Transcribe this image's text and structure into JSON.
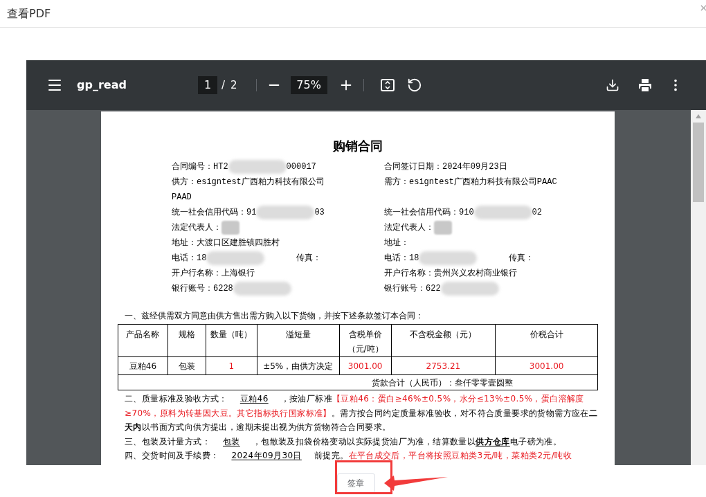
{
  "dialog": {
    "title": "查看PDF"
  },
  "viewer": {
    "file_name": "gp_read",
    "page": "1",
    "separator": "/",
    "page_count": "2",
    "zoom": "75%"
  },
  "document": {
    "title": "购销合同",
    "rows": [
      {
        "left": [
          {
            "kind": "text",
            "text": "合同编号：HT2"
          },
          {
            "kind": "redacted"
          },
          {
            "kind": "text",
            "text": "000017"
          }
        ],
        "right": [
          {
            "kind": "text",
            "text": "合同签订日期：2024年09月23日"
          }
        ]
      },
      {
        "left": [
          {
            "kind": "text",
            "text": "供方：esigntest广西粕力科技有限公司"
          }
        ],
        "right": [
          {
            "kind": "text",
            "text": "需方：esigntest广西粕力科技有限公司PAAC"
          }
        ]
      },
      {
        "left": [
          {
            "kind": "text",
            "text": "PAAD"
          }
        ],
        "right": []
      },
      {
        "left": [
          {
            "kind": "text",
            "text": "统一社会信用代码：91"
          },
          {
            "kind": "redacted"
          },
          {
            "kind": "text",
            "text": "03"
          }
        ],
        "right": [
          {
            "kind": "text",
            "text": "统一社会信用代码：910"
          },
          {
            "kind": "redacted"
          },
          {
            "kind": "text",
            "text": "02"
          }
        ]
      },
      {
        "left": [
          {
            "kind": "text",
            "text": "法定代表人："
          },
          {
            "kind": "redacted_short"
          }
        ],
        "right": [
          {
            "kind": "text",
            "text": "法定代表人："
          },
          {
            "kind": "redacted_short"
          }
        ]
      },
      {
        "left": [
          {
            "kind": "text",
            "text": "地址：大渡口区建胜镇四胜村"
          }
        ],
        "right": [
          {
            "kind": "text",
            "text": "地址："
          }
        ]
      },
      {
        "left": [
          {
            "kind": "text",
            "text": "电话：18"
          },
          {
            "kind": "redacted"
          },
          {
            "kind": "spaced",
            "text": "传真："
          }
        ],
        "right": [
          {
            "kind": "text",
            "text": "电话：18"
          },
          {
            "kind": "redacted"
          },
          {
            "kind": "spaced",
            "text": "传真："
          }
        ]
      },
      {
        "left": [
          {
            "kind": "text",
            "text": "开户行名称：上海银行"
          }
        ],
        "right": [
          {
            "kind": "text",
            "text": "开户行名称：贵州兴义农村商业银行"
          }
        ]
      },
      {
        "left": [
          {
            "kind": "text",
            "text": "银行账号：6228"
          },
          {
            "kind": "redacted"
          }
        ],
        "right": [
          {
            "kind": "text",
            "text": "银行账号：622"
          },
          {
            "kind": "redacted"
          }
        ]
      }
    ],
    "intro": "一、兹经供需双方同意由供方售出需方购入以下货物，并按下述条款签订本合同：",
    "table": {
      "columns": [
        "产品名称",
        "规格",
        "数量（吨）",
        "溢短量",
        "含税单价（元/吨）",
        "不含税金额（元）",
        "价税合计"
      ],
      "rows": [
        [
          {
            "text": "豆粕46",
            "red": false
          },
          {
            "text": "包装",
            "red": false
          },
          {
            "text": "1",
            "red": true
          },
          {
            "text": "±5%，由供方决定",
            "red": false
          },
          {
            "text": "3001.00",
            "red": true
          },
          {
            "text": "2753.21",
            "red": true
          },
          {
            "text": "3001.00",
            "red": true
          }
        ]
      ],
      "total": "货款合计（人民币）：叁仟零零壹圆整"
    },
    "clauses": [
      [
        {
          "kind": "plain",
          "text": "二、质量标准及验收方式："
        },
        {
          "kind": "underline",
          "text": "豆粕46"
        },
        {
          "kind": "plain",
          "text": "，按油厂标准"
        },
        {
          "kind": "red",
          "text": "【豆粕46：蛋白≥46%±0.5%，水分≤13%±0.5%，蛋白溶解度≥70%，原料为转基因大豆。其它指标执行国家标准】"
        },
        {
          "kind": "plain",
          "text": "。需方按合同约定质量标准验收，对不符合质量要求的货物需方应在"
        },
        {
          "kind": "bold",
          "text": "二天内"
        },
        {
          "kind": "plain",
          "text": "以书面方式向供方提出，逾期未提出视为供方货物符合合同要求。"
        }
      ],
      [
        {
          "kind": "plain",
          "text": "三、包装及计量方式："
        },
        {
          "kind": "underline",
          "text": "包装"
        },
        {
          "kind": "plain",
          "text": "，包散装及扣袋价格变动以实际提货油厂为准，结算数量以"
        },
        {
          "kind": "bold_underline",
          "text": "供方仓库"
        },
        {
          "kind": "plain",
          "text": "电子磅为准。"
        }
      ],
      [
        {
          "kind": "plain",
          "text": "四、交货时间及手续费："
        },
        {
          "kind": "underline",
          "text": "2024年09月30日"
        },
        {
          "kind": "plain",
          "text": "前提完。"
        },
        {
          "kind": "red",
          "text": "在平台成交后，平台将按照豆粕类3元/吨，菜粕类2元/吨收"
        }
      ]
    ]
  },
  "actions": {
    "sign": "签章"
  }
}
